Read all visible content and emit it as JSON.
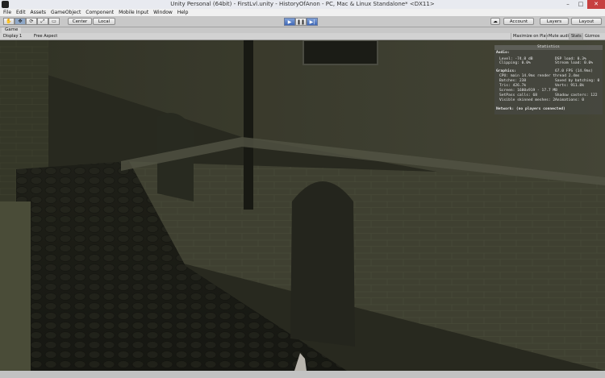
{
  "window": {
    "title": "Unity Personal (64bit) - FirstLvl.unity - HistoryOfAnon - PC, Mac & Linux Standalone* <DX11>",
    "minimize": "–",
    "maximize": "□",
    "close": "✕"
  },
  "menu": [
    "File",
    "Edit",
    "Assets",
    "GameObject",
    "Component",
    "Mobile Input",
    "Window",
    "Help"
  ],
  "toolbar": {
    "tools": [
      "hand-icon",
      "move-icon",
      "rotate-icon",
      "scale-icon",
      "rect-icon"
    ],
    "tool_glyphs": [
      "✋",
      "✥",
      "⟳",
      "⤢",
      "▭"
    ],
    "pivot": "Center",
    "space": "Local",
    "play": "▶",
    "pause": "❚❚",
    "step": "▶|",
    "cloud": "☁",
    "account": "Account",
    "layers": "Layers",
    "layout": "Layout"
  },
  "game_tab": {
    "label": "Game",
    "display": "Display 1",
    "aspect": "Free Aspect",
    "buttons": [
      "Maximize on Play",
      "Mute audio",
      "Stats",
      "Gizmos"
    ]
  },
  "stats": {
    "title": "Statistics",
    "audio_label": "Audio:",
    "level": "Level: -74.8 dB",
    "clipping": "Clipping: 0.0%",
    "dsp_load": "DSP load: 0.3%",
    "stream_load": "Stream load: 0.0%",
    "graphics_label": "Graphics:",
    "fps": "67.0 FPS (14.9ms)",
    "cpu": "CPU: main 14.9ms  render thread 2.4ms",
    "batches": "Batches: 238",
    "saved_batching": "Saved by batching: 0",
    "tris": "Tris: 426.7k",
    "verts": "Verts: 911.8k",
    "screen": "Screen: 1680x919 - 17.7 MB",
    "setpass": "SetPass calls: 68",
    "shadow_casters": "Shadow casters: 122",
    "skinned": "Visible skinned meshes: 2",
    "animations": "Animations: 0",
    "network": "Network: (no players connected)"
  },
  "colors": {
    "accent": "#3f68b8",
    "panel": "#c8c8c8",
    "close": "#c74040"
  }
}
